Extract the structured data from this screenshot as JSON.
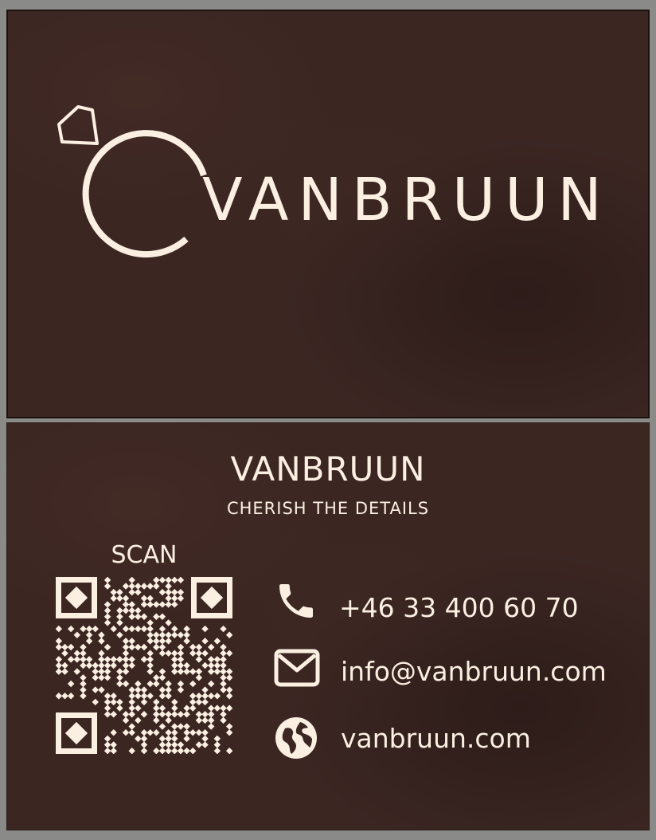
{
  "front": {
    "brand": "VANBRUUN"
  },
  "back": {
    "title": "VANBRUUN",
    "tagline": "CHERISH THE DETAILS",
    "scan_label": "SCAN",
    "contacts": [
      {
        "icon": "phone-icon",
        "text": "+46 33 400 60 70"
      },
      {
        "icon": "mail-icon",
        "text": "info@vanbruun.com"
      },
      {
        "icon": "globe-icon",
        "text": "vanbruun.com"
      }
    ]
  },
  "colors": {
    "card": "#3b2622",
    "ink": "#fbefe2",
    "frame": "#8a8a88"
  }
}
